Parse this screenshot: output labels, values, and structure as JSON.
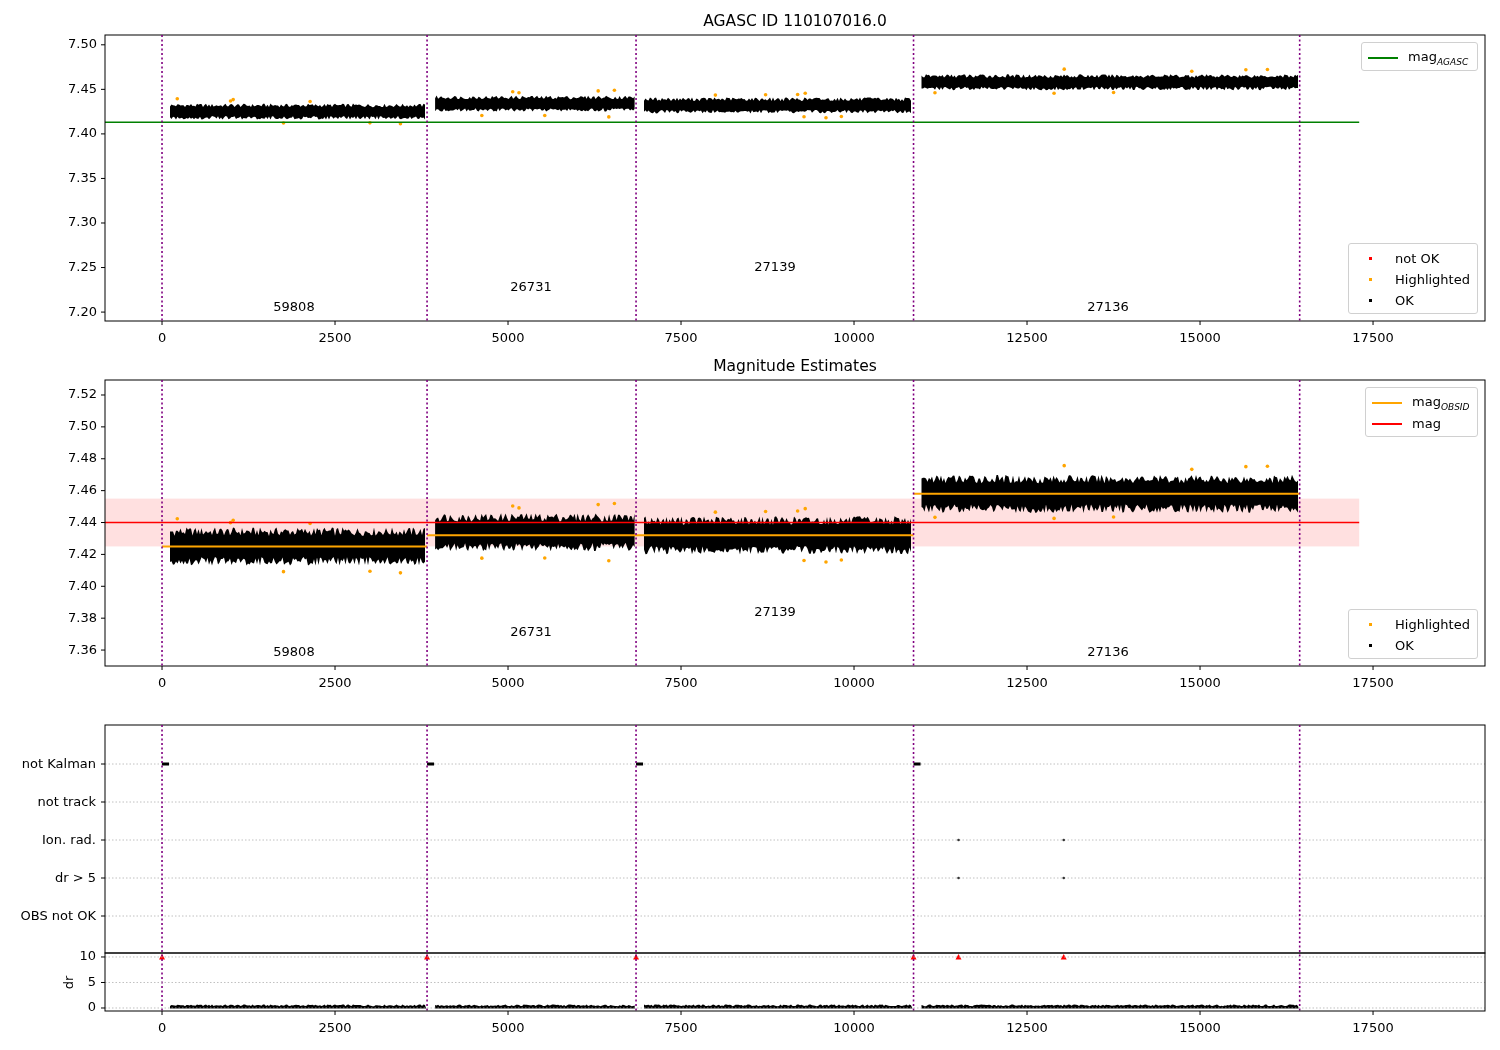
{
  "panels": [
    {
      "kind": "magnitudes",
      "chart_data": {
        "type": "line",
        "title": "AGASC ID 110107016.0",
        "xlim": [
          -824,
          19118
        ],
        "ylim": [
          7.19,
          7.511
        ],
        "xticks": [
          0,
          2500,
          5000,
          7500,
          10000,
          12500,
          15000,
          17500
        ],
        "yticks": [
          {
            "value": 7.2,
            "label": "7.20"
          },
          {
            "value": 7.25,
            "label": "7.25"
          },
          {
            "value": 7.3,
            "label": "7.30"
          },
          {
            "value": 7.35,
            "label": "7.35"
          },
          {
            "value": 7.4,
            "label": "7.40"
          },
          {
            "value": 7.45,
            "label": "7.45"
          },
          {
            "value": 7.5,
            "label": "7.50"
          }
        ],
        "x": [
          -824,
          17300
        ],
        "series": [
          {
            "name": "mag$_{AGASC}$",
            "color": "#008000",
            "values": [
              7.413,
              7.413
            ]
          }
        ],
        "annotations": [
          "59808",
          "26731",
          "27139",
          "27136"
        ]
      },
      "point_legend": [
        {
          "label": "not OK",
          "color": "#ff0000"
        },
        {
          "label": "Highlighted",
          "color": "#ffa500"
        },
        {
          "label": "OK",
          "color": "#000000"
        }
      ]
    },
    {
      "kind": "magnitudes",
      "chart_data": {
        "type": "line",
        "title": "Magnitude Estimates",
        "xlim": [
          -824,
          19118
        ],
        "ylim": [
          7.35,
          7.5294
        ],
        "xticks": [
          0,
          2500,
          5000,
          7500,
          10000,
          12500,
          15000,
          17500
        ],
        "yticks": [
          {
            "value": 7.36,
            "label": "7.36"
          },
          {
            "value": 7.38,
            "label": "7.38"
          },
          {
            "value": 7.4,
            "label": "7.40"
          },
          {
            "value": 7.42,
            "label": "7.42"
          },
          {
            "value": 7.44,
            "label": "7.44"
          },
          {
            "value": 7.46,
            "label": "7.46"
          },
          {
            "value": 7.48,
            "label": "7.48"
          },
          {
            "value": 7.5,
            "label": "7.50"
          },
          {
            "value": 7.52,
            "label": "7.52"
          }
        ],
        "x": [
          -824,
          0,
          3830,
          3830,
          3830,
          6850,
          6850,
          6850,
          10860,
          10860,
          10860,
          16440,
          17300
        ],
        "series": [
          {
            "name": "mag$_{OBSID}$",
            "color": "#ffa500",
            "values": [
              null,
              7.425,
              7.425,
              null,
              7.432,
              7.432,
              null,
              7.432,
              7.432,
              null,
              7.458,
              7.458,
              null
            ]
          },
          {
            "name": "mag",
            "color": "#ff0000",
            "values": [
              7.44,
              7.44,
              7.44,
              7.44,
              7.44,
              7.44,
              7.44,
              7.44,
              7.44,
              7.44,
              7.44,
              7.44,
              7.44
            ]
          }
        ],
        "annotations": [
          "59808",
          "26731",
          "27139",
          "27136"
        ]
      },
      "point_legend": [
        {
          "label": "Highlighted",
          "color": "#ffa500"
        },
        {
          "label": "OK",
          "color": "#000000"
        }
      ]
    },
    {
      "kind": "flags",
      "flags": [
        "not Kalman",
        "not track",
        "Ion. rad.",
        "dr > 5",
        "OBS not OK"
      ],
      "chart_data": {
        "type": "scatter",
        "ylabel": "dr",
        "xlim": [
          -824,
          19118
        ],
        "ylim": [
          -0.59,
          10.78
        ],
        "grid": true,
        "xticks": [
          0,
          2500,
          5000,
          7500,
          10000,
          12500,
          15000,
          17500
        ],
        "yticks": [
          0,
          5,
          10
        ]
      }
    }
  ]
}
